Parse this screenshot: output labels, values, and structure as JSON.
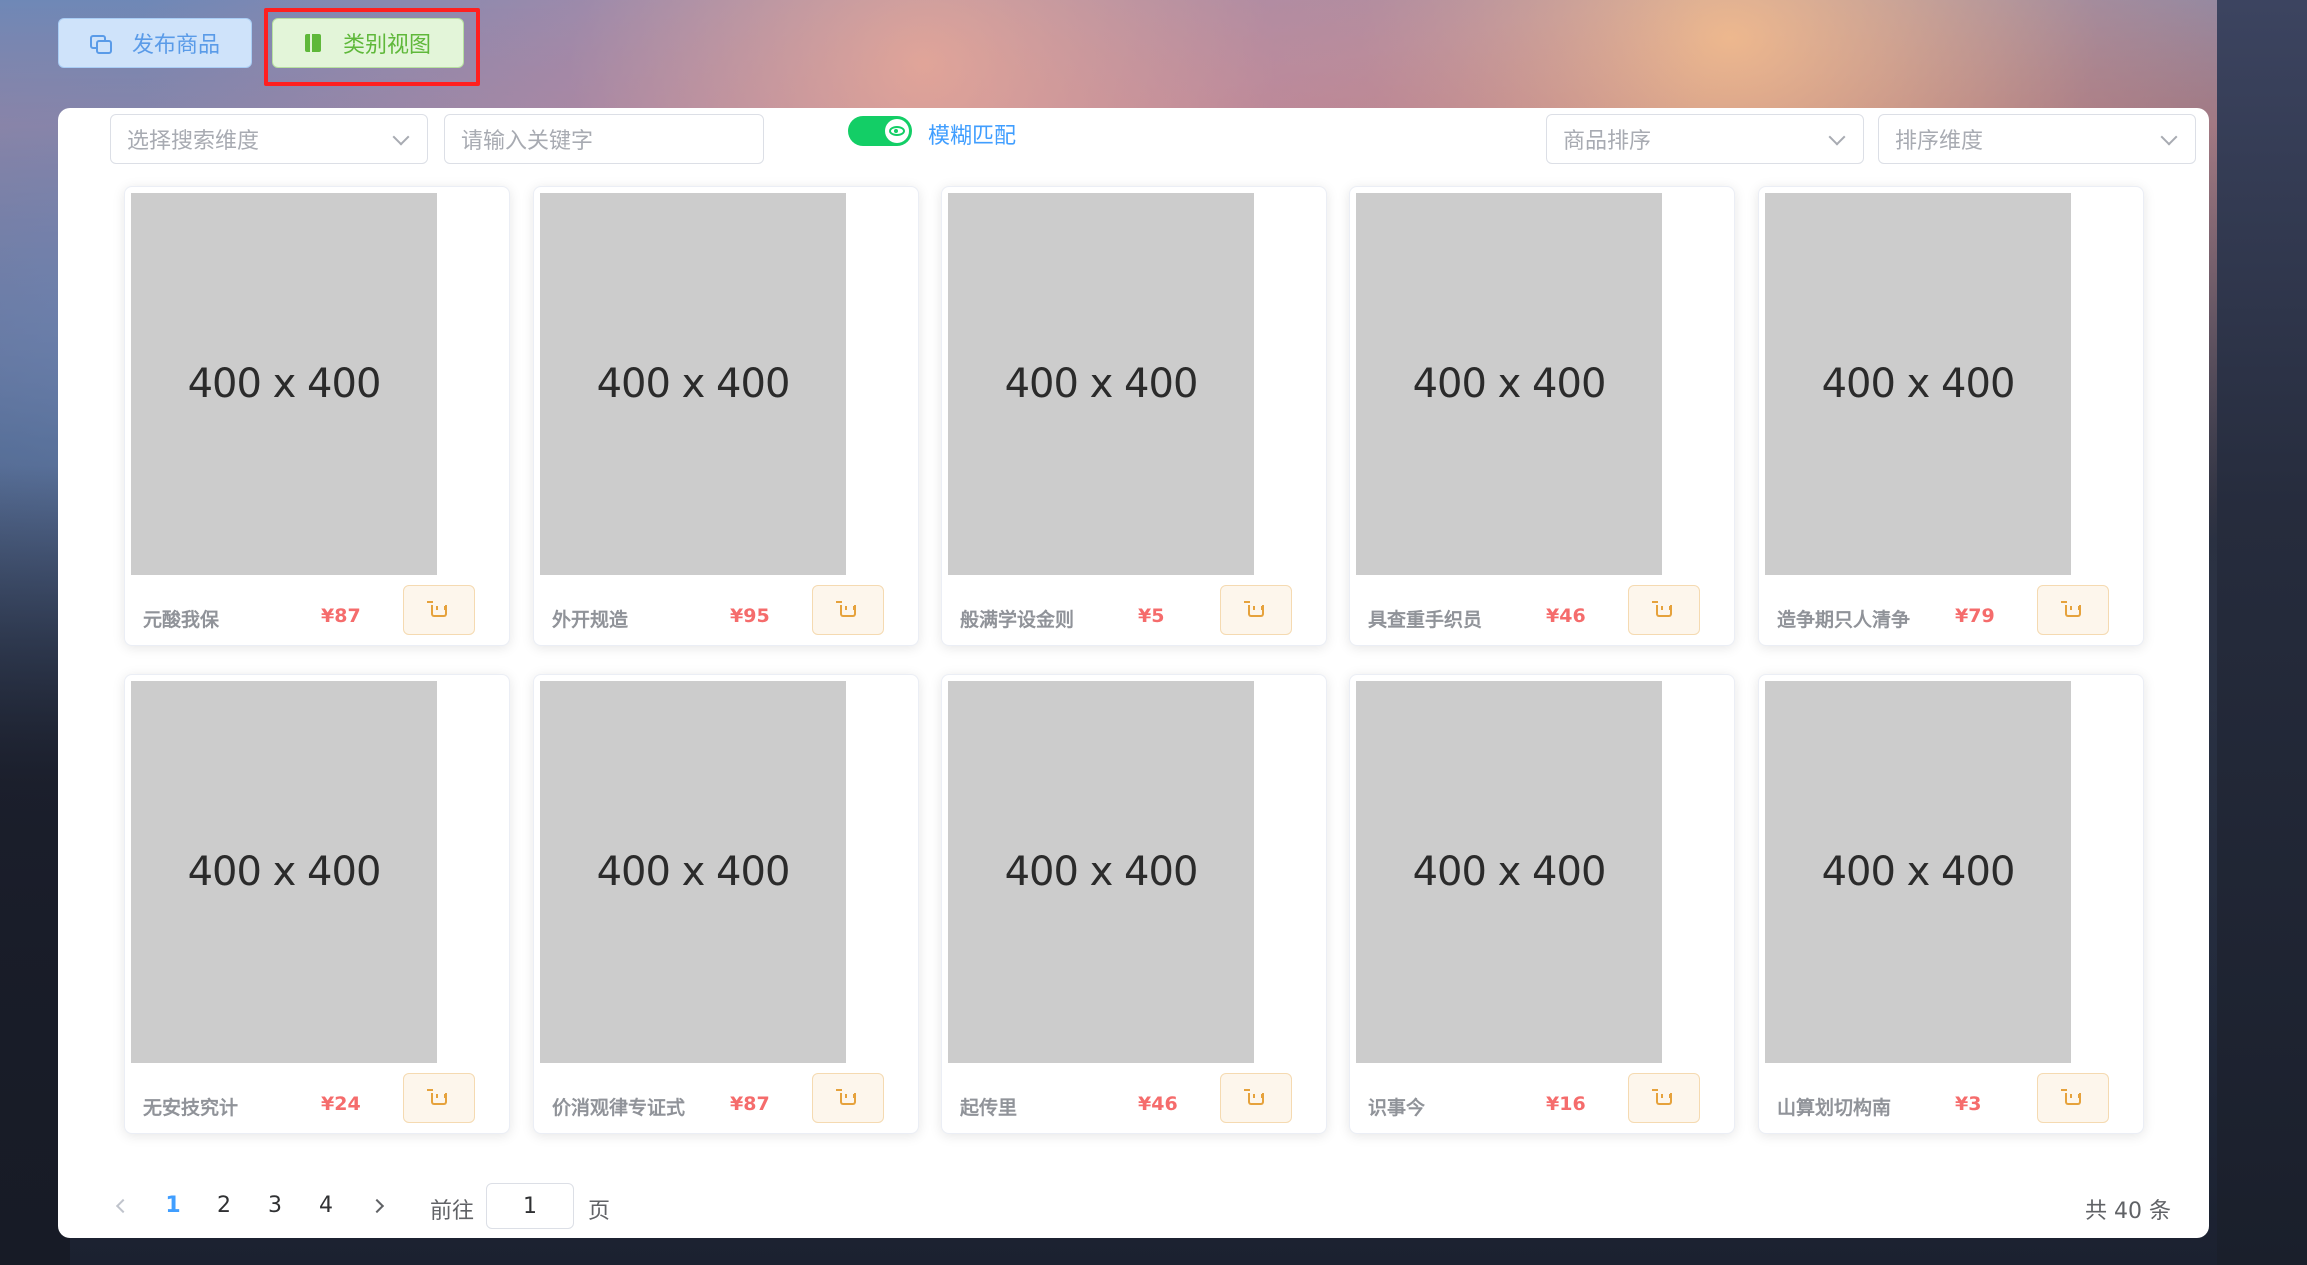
{
  "top_buttons": {
    "publish_label": "发布商品",
    "category_label": "类别视图"
  },
  "toolbar": {
    "search_dimension_placeholder": "选择搜索维度",
    "keyword_placeholder": "请输入关键字",
    "fuzzy_label": "模糊匹配",
    "fuzzy_enabled": true,
    "sort_placeholder": "商品排序",
    "sort_dimension_placeholder": "排序维度"
  },
  "products": [
    {
      "image_text": "400 x 400",
      "name": "元酸我保",
      "price": "¥87"
    },
    {
      "image_text": "400 x 400",
      "name": "外开规造",
      "price": "¥95"
    },
    {
      "image_text": "400 x 400",
      "name": "般满学设金则",
      "price": "¥5"
    },
    {
      "image_text": "400 x 400",
      "name": "具查重手织员",
      "price": "¥46"
    },
    {
      "image_text": "400 x 400",
      "name": "造争期只人清争",
      "price": "¥79"
    },
    {
      "image_text": "400 x 400",
      "name": "无安技究计",
      "price": "¥24"
    },
    {
      "image_text": "400 x 400",
      "name": "价消观律专证式",
      "price": "¥87"
    },
    {
      "image_text": "400 x 400",
      "name": "起传里",
      "price": "¥46"
    },
    {
      "image_text": "400 x 400",
      "name": "识事今",
      "price": "¥16"
    },
    {
      "image_text": "400 x 400",
      "name": "山算划切构南",
      "price": "¥3"
    }
  ],
  "pagination": {
    "pages": [
      "1",
      "2",
      "3",
      "4"
    ],
    "current_page": "1",
    "goto_label": "前往",
    "goto_value": "1",
    "page_suffix": "页",
    "total_text": "共 40 条"
  },
  "colors": {
    "accent": "#409eff",
    "price": "#f56c6c",
    "switch_on": "#13ce66",
    "cart": "#e6a23c",
    "highlight": "#ff1f1f"
  }
}
